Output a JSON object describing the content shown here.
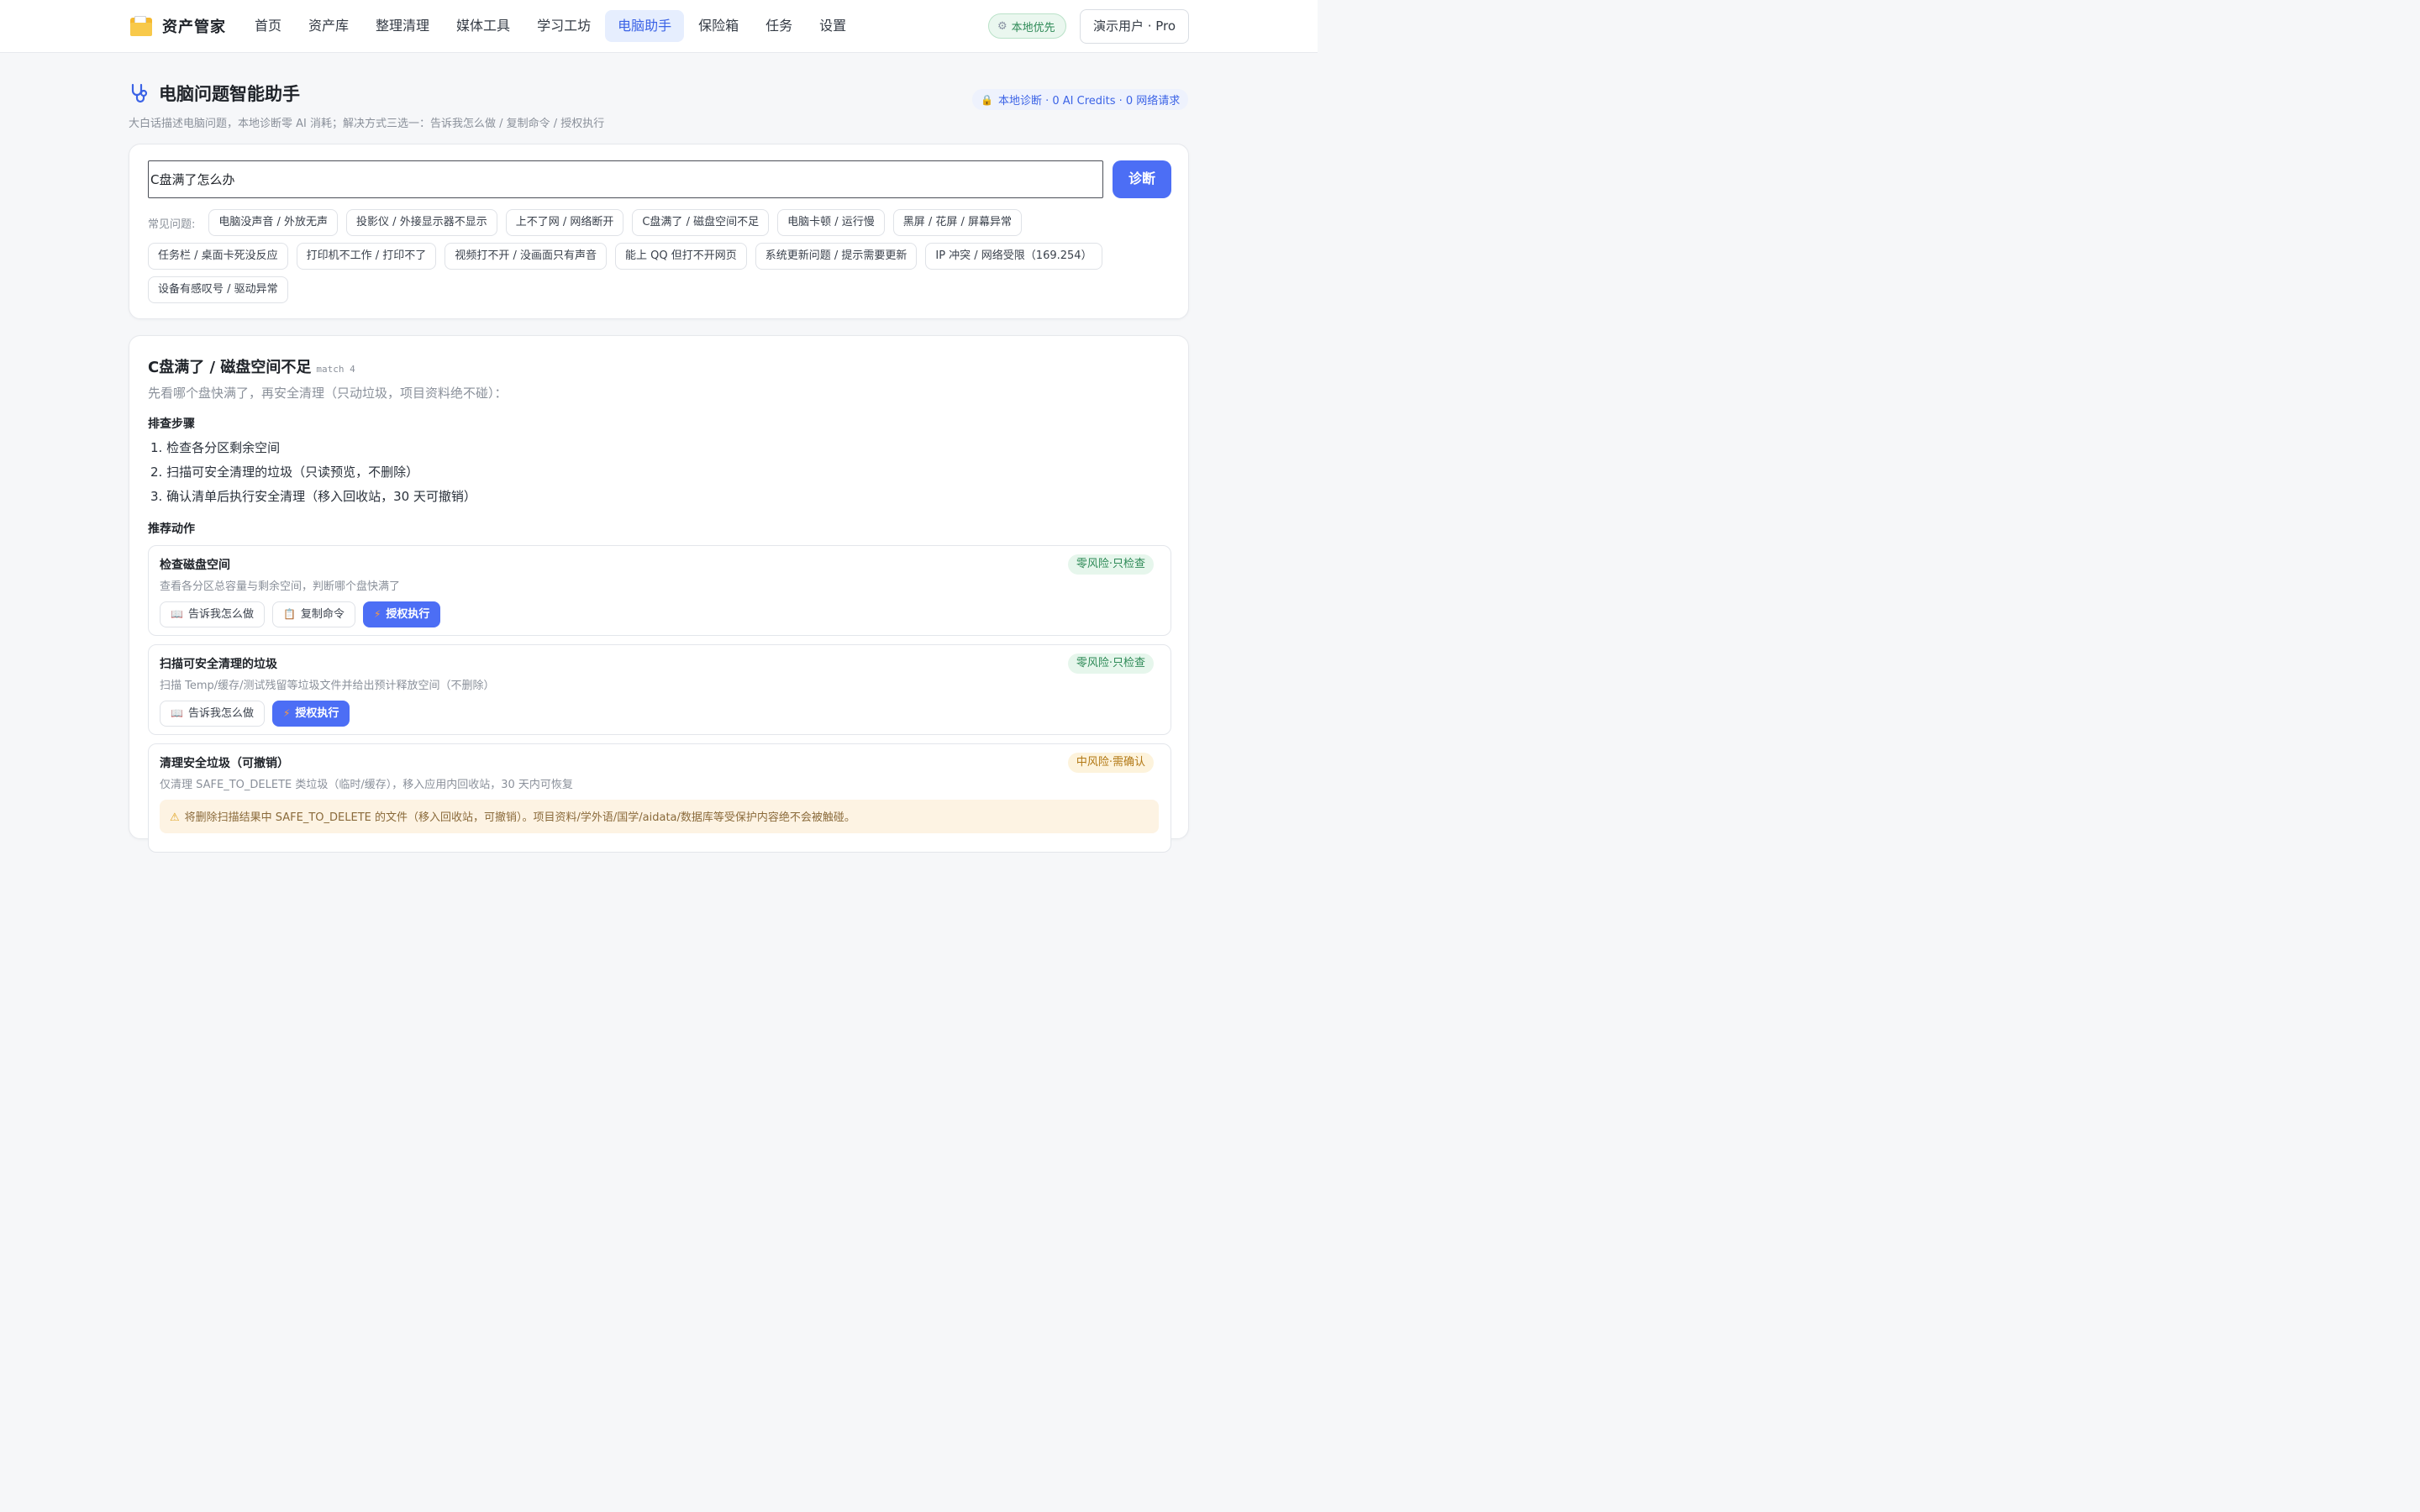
{
  "app": {
    "name": "资产管家",
    "nav": [
      {
        "label": "首页",
        "active": false
      },
      {
        "label": "资产库",
        "active": false
      },
      {
        "label": "整理清理",
        "active": false
      },
      {
        "label": "媒体工具",
        "active": false
      },
      {
        "label": "学习工坊",
        "active": false
      },
      {
        "label": "电脑助手",
        "active": true
      },
      {
        "label": "保险箱",
        "active": false
      },
      {
        "label": "任务",
        "active": false
      },
      {
        "label": "设置",
        "active": false
      }
    ],
    "local_pill": "本地优先",
    "user": "演示用户 · Pro"
  },
  "header": {
    "title": "电脑问题智能助手",
    "subtitle": "大白话描述电脑问题，本地诊断零 AI 消耗；解决方式三选一：告诉我怎么做 / 复制命令 / 授权执行",
    "privacy_badge": "本地诊断 · 0 AI Credits · 0 网络请求"
  },
  "search": {
    "value": "C盘满了怎么办",
    "button": "诊断",
    "chips_label": "常见问题:",
    "chip_rows": [
      [
        "电脑没声音 / 外放无声",
        "投影仪 / 外接显示器不显示",
        "上不了网 / 网络断开",
        "C盘满了 / 磁盘空间不足",
        "电脑卡顿 / 运行慢",
        "黑屏 / 花屏 / 屏幕异常"
      ],
      [
        "任务栏 / 桌面卡死没反应",
        "打印机不工作 / 打印不了",
        "视频打不开 / 没画面只有声音",
        "能上 QQ 但打不开网页",
        "系统更新问题 / 提示需要更新",
        "IP 冲突 / 网络受限（169.254）"
      ],
      [
        "设备有感叹号 / 驱动异常"
      ]
    ]
  },
  "result": {
    "title": "C盘满了 / 磁盘空间不足",
    "match": "match 4",
    "intro": "先看哪个盘快满了，再安全清理（只动垃圾，项目资料绝不碰）：",
    "steps_heading": "排查步骤",
    "steps": [
      "1. 检查各分区剩余空间",
      "2. 扫描可安全清理的垃圾（只读预览，不删除）",
      "3. 确认清单后执行安全清理（移入回收站，30 天可撤销）"
    ],
    "actions_heading": "推荐动作",
    "actions": [
      {
        "title": "检查磁盘空间",
        "desc": "查看各分区总容量与剩余空间，判断哪个盘快满了",
        "risk": "零风险·只检查",
        "risk_level": "zero",
        "buttons": [
          {
            "icon": "book-icon",
            "label": "告诉我怎么做"
          },
          {
            "icon": "clipboard-icon",
            "label": "复制命令"
          },
          {
            "icon": "lightning-icon",
            "label": "授权执行"
          }
        ]
      },
      {
        "title": "扫描可安全清理的垃圾",
        "desc": "扫描 Temp/缓存/测试残留等垃圾文件并给出预计释放空间（不删除）",
        "risk": "零风险·只检查",
        "risk_level": "zero",
        "buttons": [
          {
            "icon": "book-icon",
            "label": "告诉我怎么做"
          },
          {
            "icon": "lightning-icon",
            "label": "授权执行"
          }
        ]
      },
      {
        "title": "清理安全垃圾（可撤销）",
        "desc": "仅清理 SAFE_TO_DELETE 类垃圾（临时/缓存），移入应用内回收站，30 天内可恢复",
        "risk": "中风险·需确认",
        "risk_level": "mid",
        "warning": "将删除扫描结果中 SAFE_TO_DELETE 的文件（移入回收站，可撤销）。项目资料/学外语/国学/aidata/数据库等受保护内容绝不会被触碰。"
      }
    ]
  },
  "colors": {
    "accent": "#4c6ef5",
    "nav_active_bg": "#e6eefe",
    "zero_risk": "#2e8a57",
    "mid_risk": "#b27814"
  }
}
